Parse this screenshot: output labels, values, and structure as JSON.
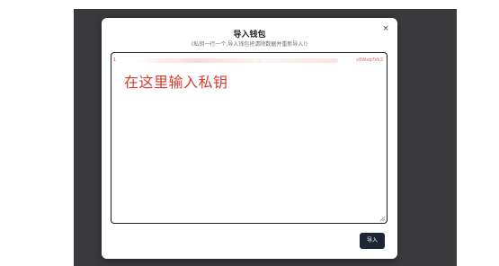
{
  "modal": {
    "title": "导入钱包",
    "subtitle": "(私钥一行一个,导入钱包将清除数据并重新导入!)",
    "close_glyph": "×",
    "import_label": "导入"
  },
  "textarea": {
    "first_line_start": "1",
    "first_line_end": "c8Wxq7Vk2",
    "overlay_text": "在这里输入私钥"
  },
  "colors": {
    "backdrop": "#3a3a3c",
    "button": "#1e2533",
    "annotation": "#d23b2f"
  },
  "icons": {
    "close": "close-icon",
    "resize": "resize-grip-icon"
  }
}
